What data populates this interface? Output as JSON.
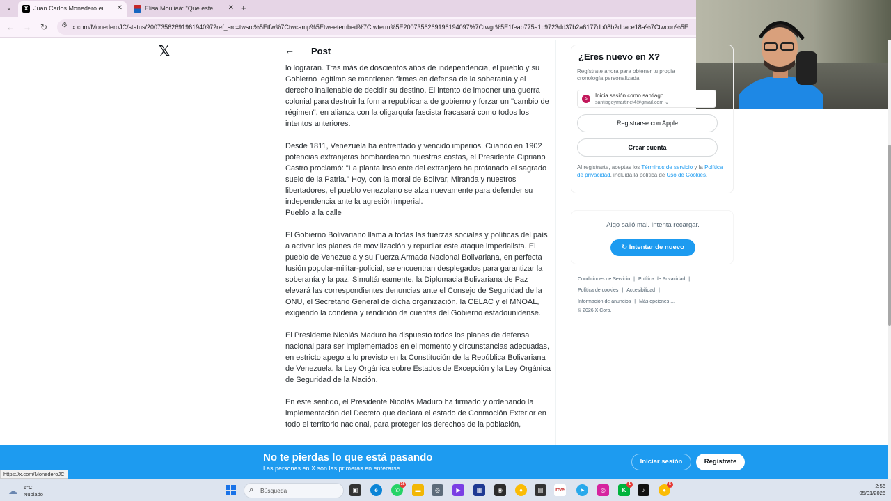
{
  "browser": {
    "tabs": [
      {
        "title": "Juan Carlos Monedero en X: \"C",
        "active": true
      },
      {
        "title": "Elisa Mouliaá: \"Que este año te",
        "active": false
      }
    ],
    "url": "x.com/MonederoJC/status/2007356269196194097?ref_src=twsrc%5Etfw%7Ctwcamp%5Etweetembed%7Ctwterm%5E2007356269196194097%7Ctwgr%5E1feab775a1c9723dd37b2a6177db08b2dbace18a%7Ctwcon%5E",
    "status_url": "https://x.com/MonederoJC"
  },
  "header": {
    "back_icon": "arrow-left-icon",
    "title": "Post"
  },
  "post": {
    "paragraphs": [
      "lo lograrán. Tras más de doscientos años de independencia, el pueblo y su Gobierno legítimo se mantienen firmes en defensa de la soberanía y el derecho inalienable de decidir su destino. El intento de imponer una guerra colonial para destruir la forma republicana de gobierno y forzar un \"cambio de régimen\", en alianza con la oligarquía fascista fracasará como todos los intentos anteriores.",
      "Desde 1811, Venezuela ha enfrentado y vencido imperios. Cuando en 1902 potencias extranjeras bombardearon nuestras costas, el Presidente Cipriano Castro proclamó: \"La planta insolente del extranjero ha profanado el sagrado suelo de la Patria.\" Hoy, con la moral de Bolívar, Miranda y nuestros libertadores, el pueblo venezolano se alza nuevamente para defender su independencia ante la agresión imperial.",
      "Pueblo a la calle",
      "El Gobierno Bolivariano llama a todas las fuerzas sociales y políticas del país a activar los planes de movilización y repudiar este ataque imperialista. El pueblo de Venezuela y su Fuerza Armada Nacional Bolivariana, en perfecta fusión popular-militar-policial, se encuentran desplegados para garantizar la soberanía y la paz. Simultáneamente, la Diplomacia Bolivariana de Paz elevará las correspondientes denuncias ante el Consejo de Seguridad de la ONU, el Secretario General de dicha organización, la CELAC y el MNOAL, exigiendo la condena y rendición de cuentas del Gobierno estadounidense.",
      "El Presidente Nicolás Maduro ha dispuesto todos los planes de defensa nacional para ser implementados en el momento y circunstancias adecuadas, en estricto apego a lo previsto en la Constitución de la República Bolivariana de Venezuela, la Ley Orgánica sobre Estados de Excepción y la Ley Orgánica de Seguridad de la Nación.",
      "En este sentido, el Presidente Nicolás Maduro ha firmado y ordenando la implementación del Decreto que declara el estado de Conmoción Exterior en todo el territorio nacional, para proteger los derechos de la población,"
    ]
  },
  "signup": {
    "title": "¿Eres nuevo en X?",
    "subtitle": "Regístrate ahora para obtener tu propia cronología personalizada.",
    "google_account": {
      "label": "Inicia sesión como santiago",
      "email": "santiagoymartinet4@gmail.com",
      "avatar_letter": "s"
    },
    "apple_label": "Registrarse con Apple",
    "create_label": "Crear cuenta",
    "terms_prefix": "Al registrarte, aceptas los ",
    "terms_link": "Términos de servicio",
    "terms_mid": " y la ",
    "privacy_link": "Política de privacidad",
    "terms_mid2": ", incluida la política de ",
    "cookies_link": "Uso de Cookies",
    "terms_end": "."
  },
  "trends_error": {
    "message": "Algo salió mal. Intenta recargar.",
    "retry_label": "Intentar de nuevo"
  },
  "footer": {
    "links": [
      "Condiciones de Servicio",
      "Política de Privacidad",
      "Política de cookies",
      "Accesibilidad",
      "Información de anuncios",
      "Más opciones ..."
    ],
    "copyright": "© 2026 X Corp."
  },
  "banner": {
    "title": "No te pierdas lo que está pasando",
    "subtitle": "Las personas en X son las primeras en enterarse.",
    "login_label": "Iniciar sesión",
    "register_label": "Regístrate"
  },
  "taskbar": {
    "weather_temp": "6°C",
    "weather_cond": "Nublado",
    "search_placeholder": "Búsqueda",
    "time": "2:56",
    "date": "05/01/2026"
  },
  "colors": {
    "x_blue": "#1d9bf0",
    "tab_bar": "#e6d5e6",
    "text": "#0f1419"
  }
}
